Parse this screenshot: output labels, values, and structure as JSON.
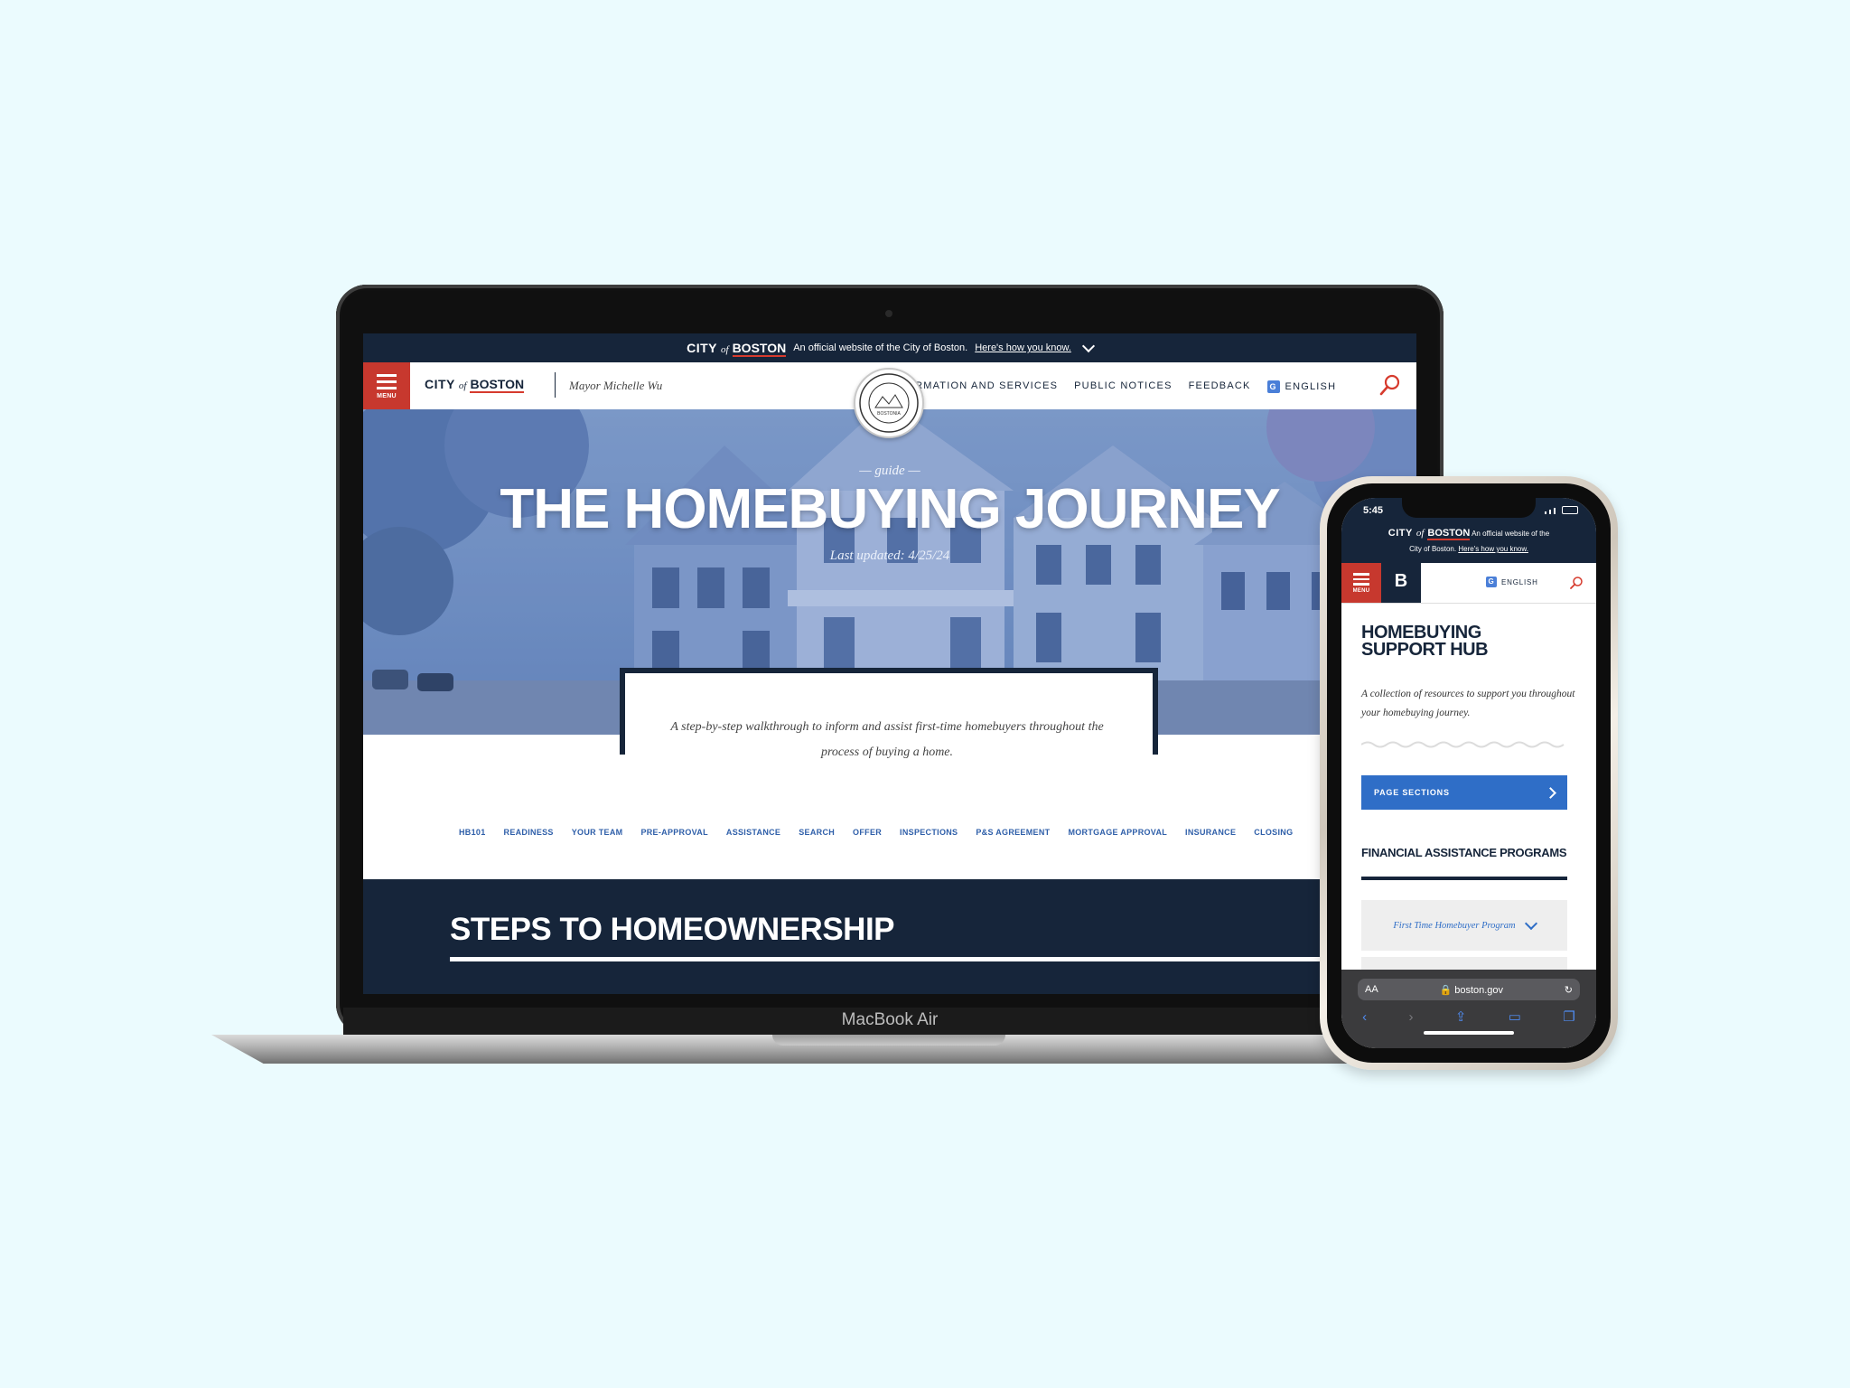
{
  "official_banner": {
    "city": "CITY",
    "of": "of",
    "boston": "BOSTON",
    "text": "An official website of the City of Boston.",
    "link": "Here's how you know."
  },
  "header": {
    "menu_label": "MENU",
    "mayor": "Mayor Michelle Wu",
    "nav": [
      "INFORMATION AND SERVICES",
      "PUBLIC NOTICES",
      "FEEDBACK"
    ],
    "language": "ENGLISH"
  },
  "seal": {
    "text": "BOSTONIA"
  },
  "hero": {
    "eyebrow": "— guide —",
    "title": "THE HOMEBUYING JOURNEY",
    "updated": "Last updated: 4/25/24"
  },
  "intro": "A step-by-step walkthrough to inform and assist first-time homebuyers throughout the process of buying a home.",
  "tabs": [
    "HB101",
    "READINESS",
    "YOUR TEAM",
    "PRE-APPROVAL",
    "ASSISTANCE",
    "SEARCH",
    "OFFER",
    "INSPECTIONS",
    "P&S AGREEMENT",
    "MORTGAGE APPROVAL",
    "INSURANCE",
    "CLOSING"
  ],
  "section_title": "STEPS TO HOMEOWNERSHIP",
  "laptop_model": "MacBook Air",
  "phone": {
    "time": "5:45",
    "official_text": "An official website of the",
    "official_text2": "City of Boston.",
    "official_link": "Here's how you know.",
    "b_logo": "B",
    "menu_label": "MENU",
    "language": "ENGLISH",
    "hub_title": "HOMEBUYING SUPPORT HUB",
    "hub_subtitle": "A collection of resources to support you throughout your homebuying journey.",
    "page_sections": "PAGE SECTIONS",
    "fin_title": "FINANCIAL ASSISTANCE PROGRAMS",
    "accordion_item": "First Time Homebuyer Program",
    "url_aa": "AA",
    "url": "boston.gov"
  },
  "colors": {
    "navy": "#16253a",
    "red": "#c7382e",
    "blue": "#2f6ec7",
    "background": "#ebfbfe"
  }
}
